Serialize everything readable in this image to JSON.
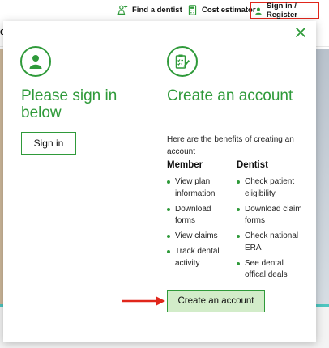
{
  "topbar": {
    "find_dentist": "Find a dentist",
    "cost_estimator": "Cost estimator",
    "sign_in_register": "Sign in / Register"
  },
  "subheader": {
    "partial_text": "C"
  },
  "modal": {
    "left": {
      "icon": "user-icon",
      "title": "Please sign in below",
      "sign_in_label": "Sign in"
    },
    "right": {
      "icon": "clipboard-edit-icon",
      "title": "Create an account",
      "intro": "Here are the benefits of creating an account",
      "member": {
        "heading": "Member",
        "items": [
          "View plan information",
          "Download forms",
          "View claims",
          "Track dental activity"
        ]
      },
      "dentist": {
        "heading": "Dentist",
        "items": [
          "Check patient eligibility",
          "Download claim forms",
          "Check national ERA",
          "See dental offical deals"
        ]
      },
      "create_label": "Create an account"
    }
  },
  "colors": {
    "brand_green": "#2f9a3a",
    "button_fill": "#d2ecc9",
    "highlight_red": "#e0261b",
    "footer_accent": "#4ec6c0"
  }
}
